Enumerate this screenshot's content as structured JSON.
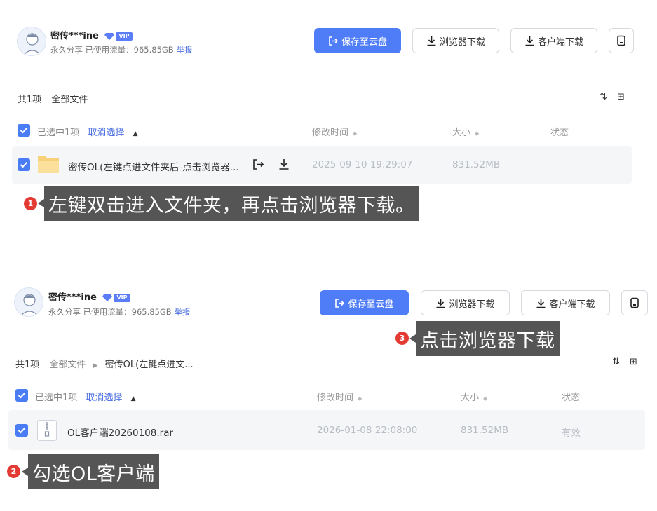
{
  "top": {
    "user": {
      "name": "密传***ine",
      "vip": "VIP"
    },
    "meta": {
      "text": "永久分享  已使用流量：965.85GB",
      "report": "举报"
    },
    "buttons": {
      "save": "保存至云盘",
      "browser": "浏览器下载",
      "client": "客户端下载"
    },
    "breadcrumb": {
      "count": "共1项",
      "root": "全部文件"
    },
    "header": {
      "selected": "已选中1项",
      "cancel": "取消选择",
      "modified": "修改时间",
      "size": "大小",
      "status": "状态"
    },
    "row": {
      "name": "密传OL(左键点进文件夹后-点击浏览器...",
      "date": "2025-09-10 19:29:07",
      "size": "831.52MB",
      "status": "-"
    }
  },
  "bottom": {
    "user": {
      "name": "密传***ine",
      "vip": "VIP"
    },
    "meta": {
      "text": "永久分享  已使用流量：965.85GB",
      "report": "举报"
    },
    "buttons": {
      "save": "保存至云盘",
      "browser": "浏览器下载",
      "client": "客户端下载"
    },
    "breadcrumb": {
      "count": "共1项",
      "root": "全部文件",
      "folder": "密传OL(左键点进文..."
    },
    "header": {
      "selected": "已选中1项",
      "cancel": "取消选择",
      "modified": "修改时间",
      "size": "大小",
      "status": "状态"
    },
    "row": {
      "name": "OL客户端20260108.rar",
      "date": "2026-01-08 22:08:00",
      "size": "831.52MB",
      "status": "有效"
    }
  },
  "annotations": {
    "one": {
      "num": "1",
      "text": "左键双击进入文件夹，再点击浏览器下载。"
    },
    "two": {
      "num": "2",
      "text": "勾选OL客户端"
    },
    "three": {
      "num": "3",
      "text": "点击浏览器下载"
    }
  },
  "colors": {
    "primary": "#4f7cf7",
    "callout": "#555555",
    "badge": "#e33a34",
    "link": "#4a6ee0"
  },
  "icons": {
    "sort": "sort-icon",
    "grid": "grid-view-icon",
    "folder": "folder-icon",
    "archive": "archive-file-icon"
  }
}
